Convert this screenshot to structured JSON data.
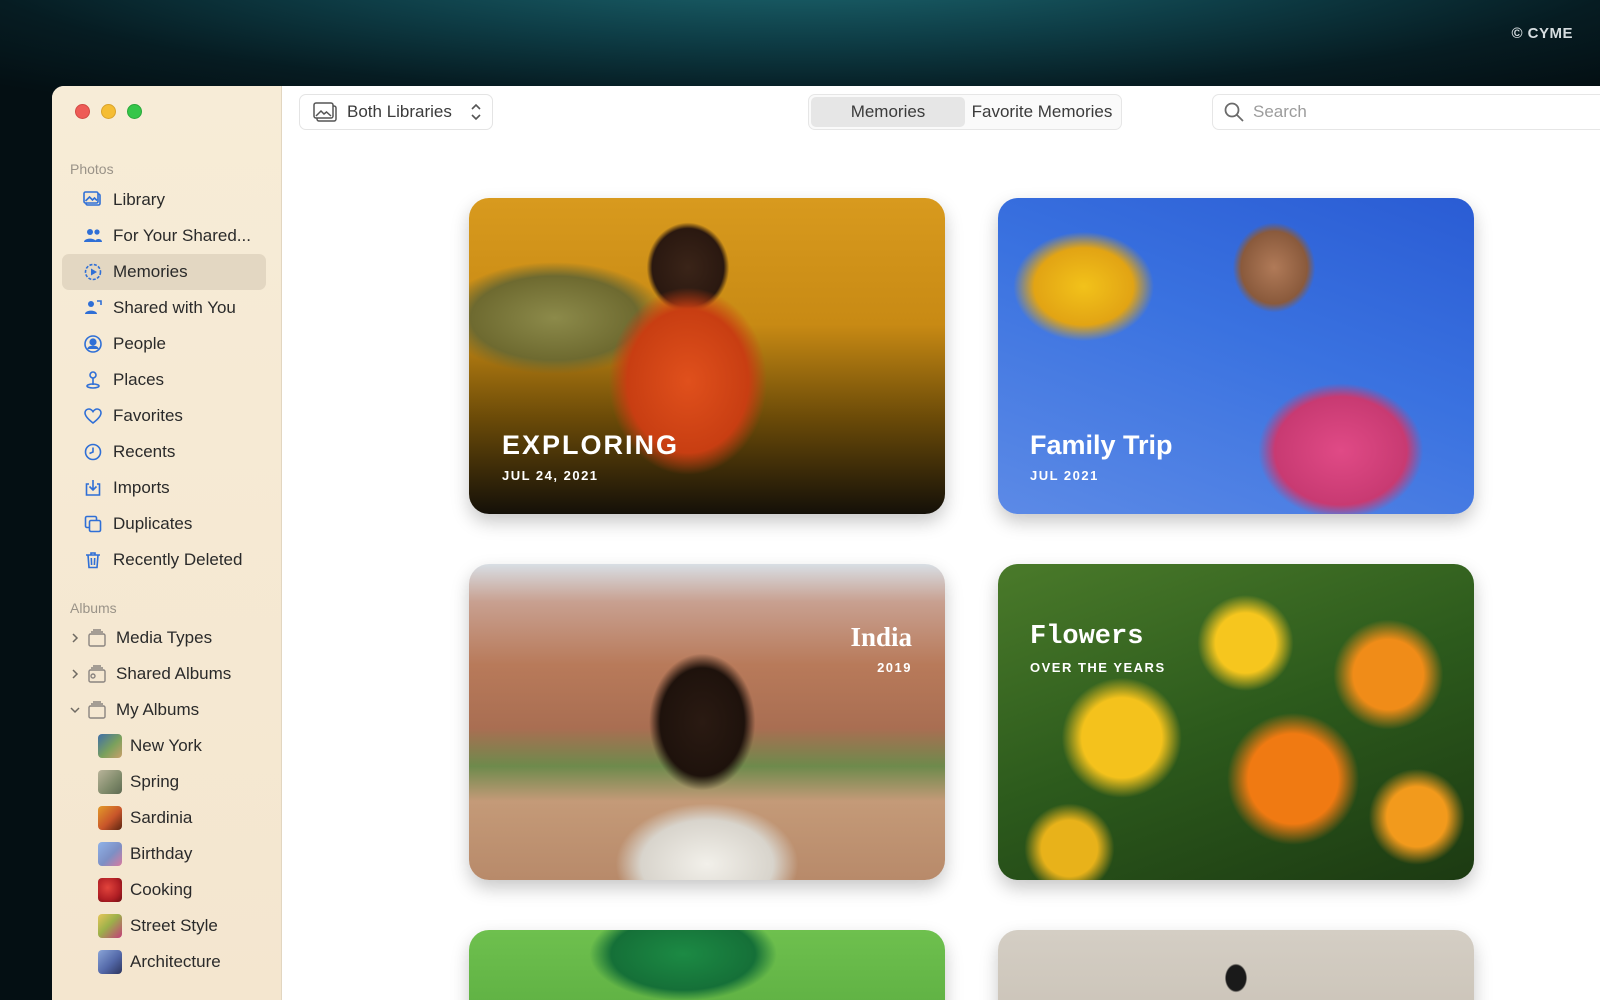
{
  "watermark": "© CYME",
  "sidebar": {
    "photos_section": "Photos",
    "photos_items": [
      {
        "label": "Library",
        "icon": "library-icon"
      },
      {
        "label": "For Your Shared...",
        "icon": "shared-people-icon"
      },
      {
        "label": "Memories",
        "icon": "memories-icon",
        "active": true
      },
      {
        "label": "Shared with You",
        "icon": "shared-with-you-icon"
      },
      {
        "label": "People",
        "icon": "person-icon"
      },
      {
        "label": "Places",
        "icon": "pin-icon"
      },
      {
        "label": "Favorites",
        "icon": "heart-icon"
      },
      {
        "label": "Recents",
        "icon": "clock-icon"
      },
      {
        "label": "Imports",
        "icon": "import-icon"
      },
      {
        "label": "Duplicates",
        "icon": "duplicates-icon"
      },
      {
        "label": "Recently Deleted",
        "icon": "trash-icon"
      }
    ],
    "albums_section": "Albums",
    "album_groups": [
      {
        "label": "Media Types",
        "expanded": false
      },
      {
        "label": "Shared Albums",
        "expanded": false
      },
      {
        "label": "My Albums",
        "expanded": true
      }
    ],
    "my_albums": [
      {
        "label": "New York",
        "color": "#6c8e5a"
      },
      {
        "label": "Spring",
        "color": "#9b9a7c"
      },
      {
        "label": "Sardinia",
        "color": "#c8552a"
      },
      {
        "label": "Birthday",
        "color": "#7d8fc4"
      },
      {
        "label": "Cooking",
        "color": "#c0252a"
      },
      {
        "label": "Street Style",
        "color": "#c3a24c"
      },
      {
        "label": "Architecture",
        "color": "#5368a8"
      }
    ]
  },
  "toolbar": {
    "library_picker": "Both Libraries",
    "tabs": [
      "Memories",
      "Favorite Memories"
    ],
    "search_placeholder": "Search"
  },
  "memories": [
    {
      "title": "EXPLORING",
      "subtitle": "JUL 24, 2021"
    },
    {
      "title": "Family Trip",
      "subtitle": "JUL 2021"
    },
    {
      "title": "India",
      "subtitle": "2019"
    },
    {
      "title": "Flowers",
      "subtitle": "OVER THE YEARS"
    }
  ],
  "colors": {
    "sidebar_bg": "#f5e8d2",
    "active_item": "#e3d7c2",
    "icon_blue": "#2f6fd6"
  }
}
